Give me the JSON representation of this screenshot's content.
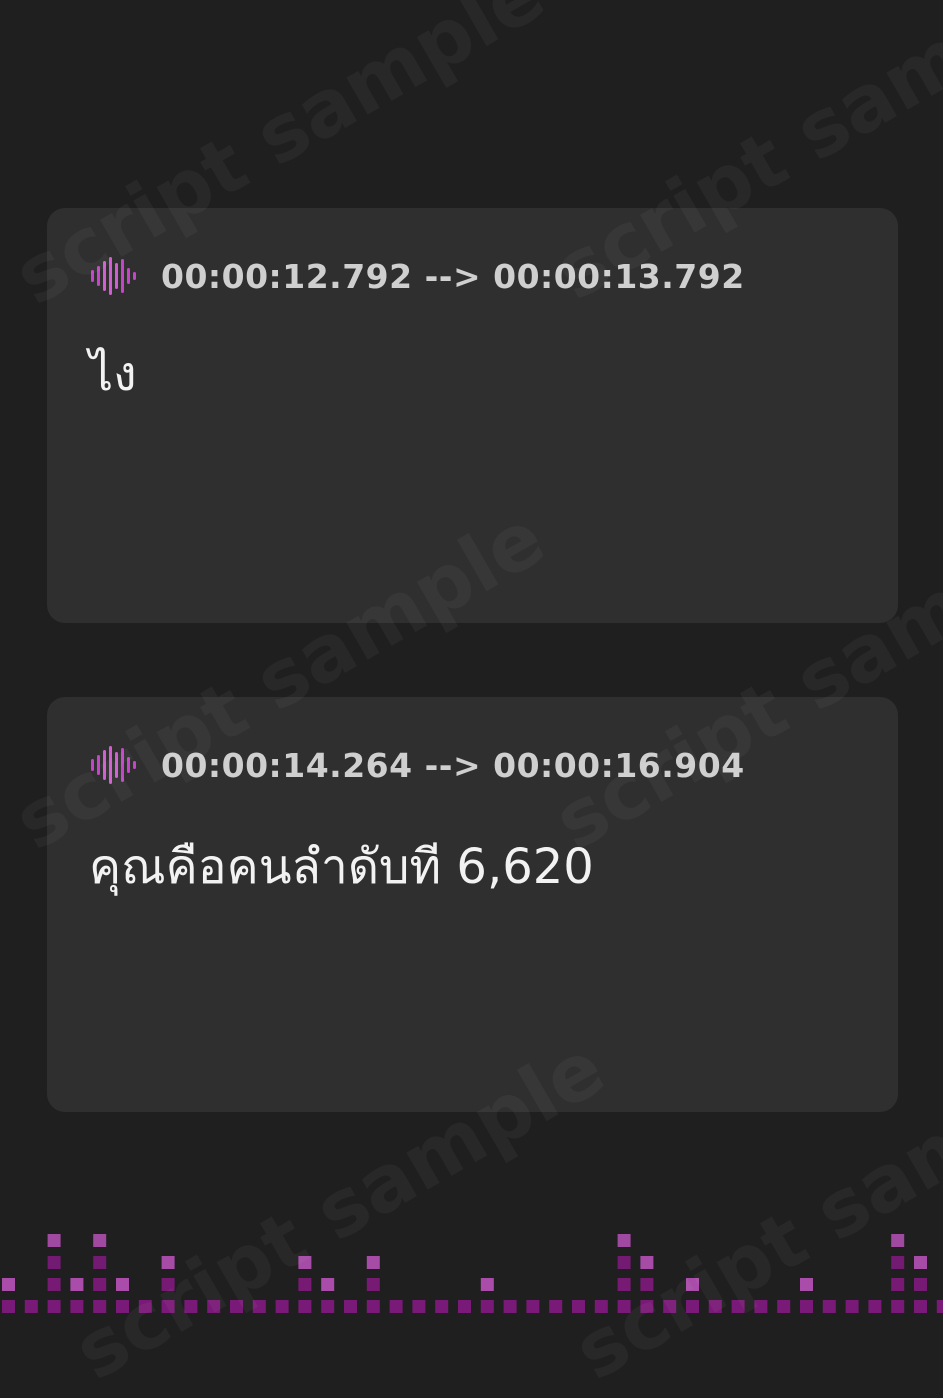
{
  "watermark": {
    "text": "script sample"
  },
  "cues": [
    {
      "timestamp": "00:00:12.792 --> 00:00:13.792",
      "text": "ไง",
      "icon": "audio-wave-icon"
    },
    {
      "timestamp": "00:00:14.264 --> 00:00:16.904",
      "text": "คุณคือคนลำดับที 6,620",
      "icon": "audio-wave-icon"
    }
  ],
  "colors": {
    "background": "#1f1f1f",
    "card": "#2f2f2f",
    "timestamp": "#cfcfcf",
    "caption": "#f2f2f2",
    "accent_magenta": "#c545c8",
    "equalizer_bright": "#b04fb0",
    "equalizer_dim": "#7a1a78"
  },
  "equalizer": {
    "icon": "equalizer-bars-decoration",
    "levels": [
      2,
      1,
      4,
      2,
      4,
      2,
      1,
      3,
      1,
      1,
      1,
      1,
      1,
      3,
      2,
      1,
      3,
      1,
      1,
      1,
      1,
      2,
      1,
      1,
      1,
      1,
      1,
      4,
      3,
      1,
      2,
      1,
      1,
      1,
      1,
      2,
      1,
      1,
      1,
      4,
      3,
      1,
      2,
      1,
      1,
      1,
      1,
      1,
      1,
      2,
      1,
      4,
      5,
      1,
      2,
      1,
      1,
      1,
      1,
      2,
      1,
      1,
      1,
      4,
      3,
      2,
      1,
      1,
      1,
      2,
      1,
      1,
      4,
      2,
      1
    ]
  }
}
